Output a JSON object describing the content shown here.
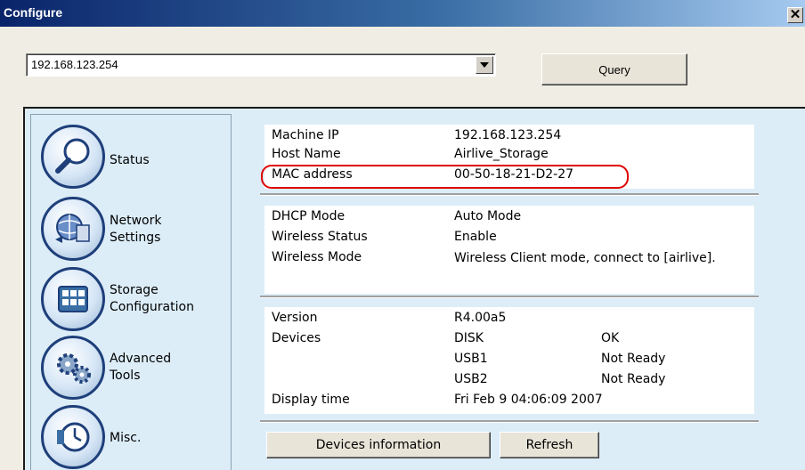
{
  "window": {
    "title": "Configure",
    "close_glyph": "✕"
  },
  "address": {
    "value": "192.168.123.254"
  },
  "toolbar": {
    "query_label": "Query"
  },
  "sidebar": {
    "items": [
      {
        "label_line1": "Status",
        "label_line2": "",
        "icon": "magnifier-icon"
      },
      {
        "label_line1": "Network",
        "label_line2": "Settings",
        "icon": "network-globe-icon"
      },
      {
        "label_line1": "Storage",
        "label_line2": "Configuration",
        "icon": "storage-grid-icon"
      },
      {
        "label_line1": "Advanced",
        "label_line2": "Tools",
        "icon": "gears-icon"
      },
      {
        "label_line1": "Misc.",
        "label_line2": "",
        "icon": "clock-icon"
      }
    ]
  },
  "machine": {
    "ip_label": "Machine IP",
    "ip_value": "192.168.123.254",
    "host_label": "Host Name",
    "host_value": "Airlive_Storage",
    "mac_label": "MAC address",
    "mac_value": "00-50-18-21-D2-27"
  },
  "network": {
    "dhcp_label": "DHCP Mode",
    "dhcp_value": "Auto Mode",
    "wstatus_label": "Wireless Status",
    "wstatus_value": "Enable",
    "wmode_label": "Wireless Mode",
    "wmode_value": "Wireless Client mode, connect to [airlive]."
  },
  "system": {
    "version_label": "Version",
    "version_value": "R4.00a5",
    "devices_label": "Devices",
    "devices": [
      {
        "name": "DISK",
        "state": "OK"
      },
      {
        "name": "USB1",
        "state": "Not Ready"
      },
      {
        "name": "USB2",
        "state": "Not Ready"
      }
    ],
    "time_label": "Display time",
    "time_value": "Fri Feb 9 04:06:09 2007"
  },
  "actions": {
    "devices_info_label": "Devices information",
    "refresh_label": "Refresh"
  },
  "colors": {
    "title_bar": "#0a246a",
    "panel_bg": "#dcedf8",
    "highlight": "#e00000",
    "icon_ring": "#1e3f7a"
  }
}
